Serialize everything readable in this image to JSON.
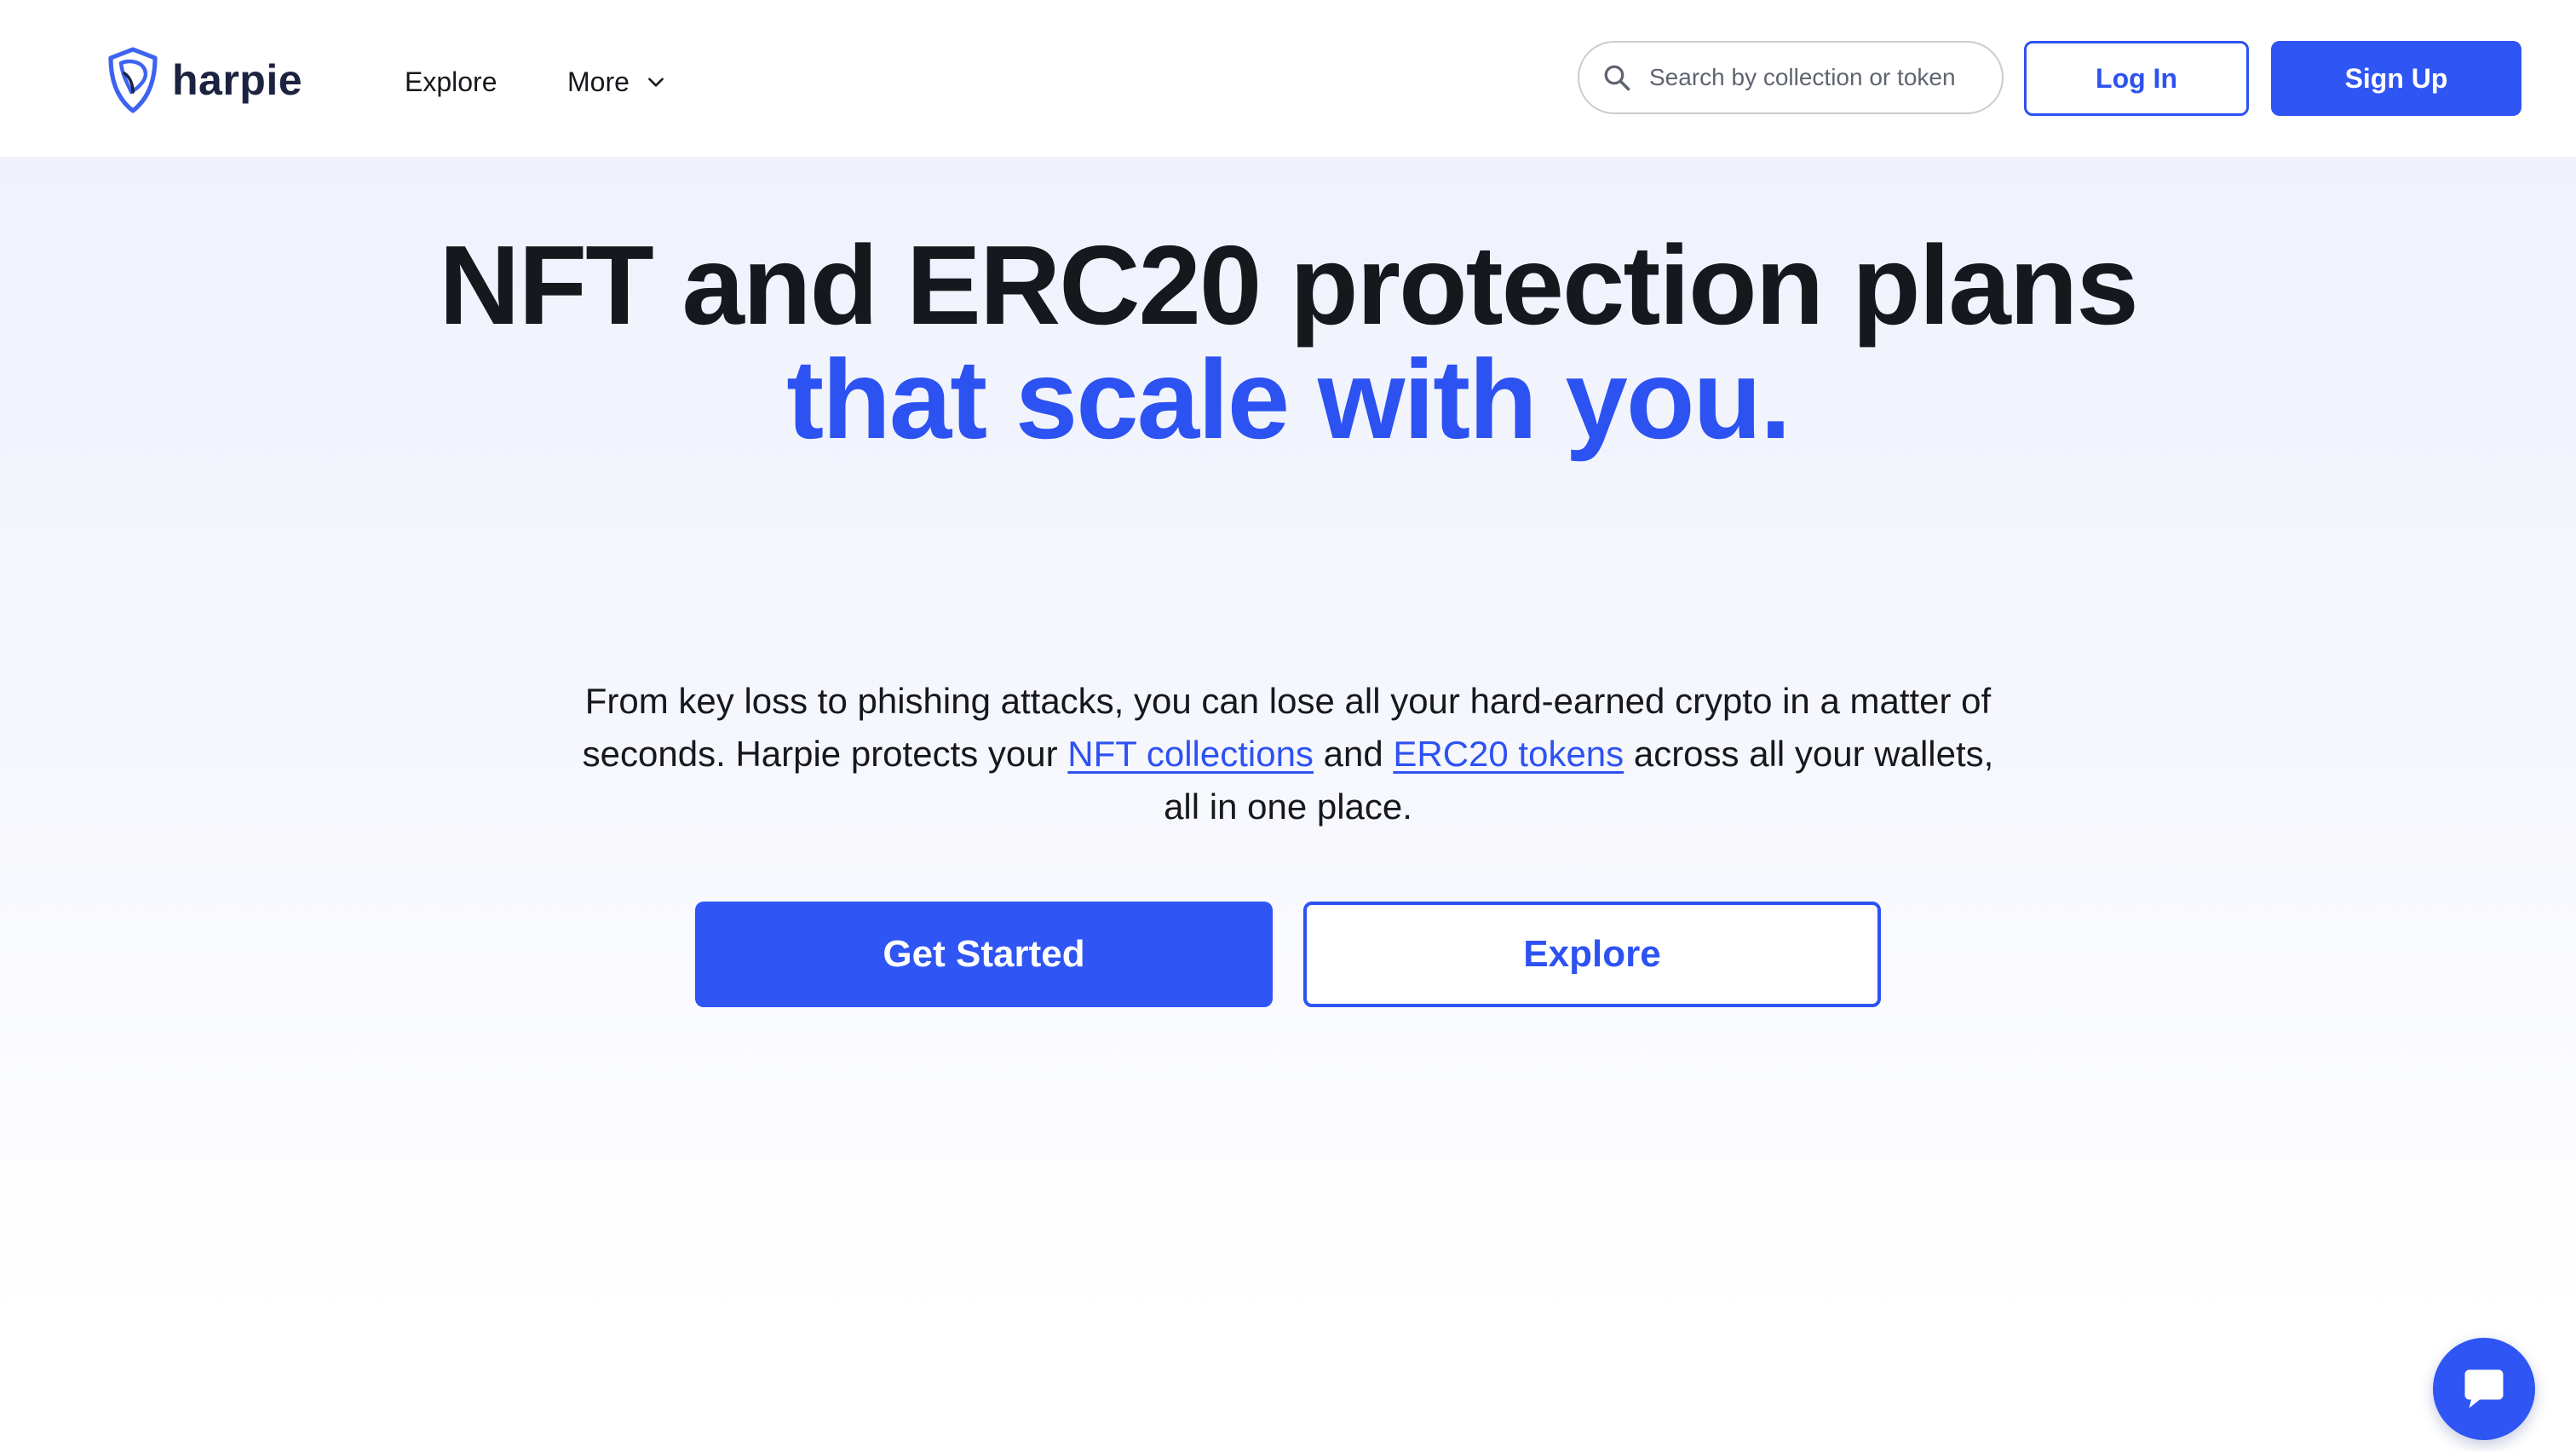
{
  "brand": {
    "name": "harpie",
    "accent_color": "#2f55f4",
    "text_color": "#16181d"
  },
  "nav": {
    "explore_label": "Explore",
    "more_label": "More",
    "more_icon": "chevron-down-icon"
  },
  "search": {
    "placeholder": "Search by collection or token",
    "value": "",
    "icon": "search-icon"
  },
  "auth": {
    "login_label": "Log In",
    "signup_label": "Sign Up"
  },
  "hero": {
    "headline_line1": "NFT and ERC20 protection plans",
    "headline_line2": "that scale with you.",
    "sub_part1": "From key loss to phishing attacks, you can lose all your hard-earned crypto in a matter of seconds. Harpie protects your ",
    "sub_link1": "NFT collections",
    "sub_part2": " and ",
    "sub_link2": "ERC20 tokens",
    "sub_part3": " across all your wallets, all in one place.",
    "primary_cta": "Get Started",
    "secondary_cta": "Explore"
  },
  "chat": {
    "icon": "chat-icon"
  }
}
